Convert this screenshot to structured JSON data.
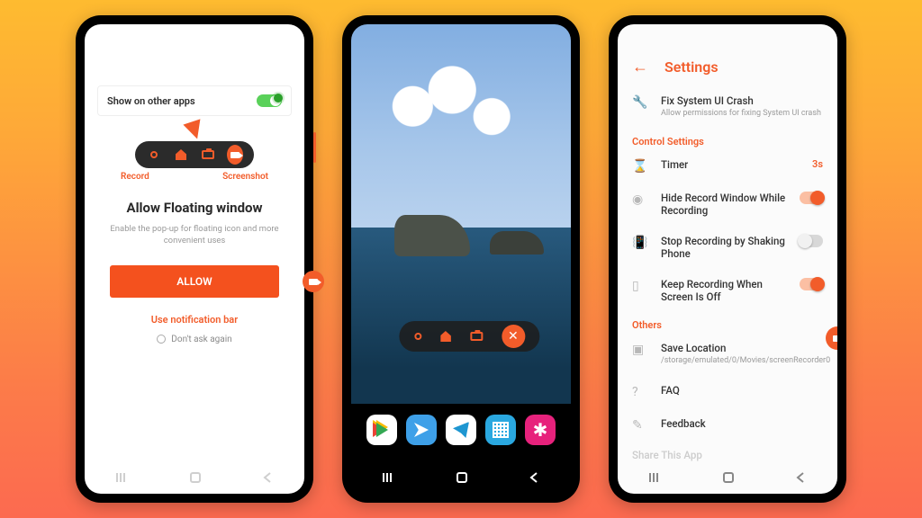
{
  "phone1": {
    "card_label": "Show on other apps",
    "pill_labels": {
      "record": "Record",
      "screenshot": "Screenshot"
    },
    "heading": "Allow Floating window",
    "subtext": "Enable the pop-up for floating icon and more convenient uses",
    "allow_button": "ALLOW",
    "notification_link": "Use notification bar",
    "dont_ask": "Don't ask again"
  },
  "phone2": {
    "pill_icons": [
      "record",
      "home",
      "camera",
      "close"
    ],
    "dock_apps": [
      "play-store",
      "bird",
      "telegram",
      "qr",
      "flower"
    ]
  },
  "phone3": {
    "title": "Settings",
    "fix_ui": {
      "title": "Fix System UI Crash",
      "sub": "Allow permissions for fixing System UI crash"
    },
    "section_control": "Control Settings",
    "timer": {
      "label": "Timer",
      "value": "3s"
    },
    "hide_window": {
      "label": "Hide Record Window While Recording",
      "on": true
    },
    "shake": {
      "label": "Stop Recording by Shaking Phone",
      "on": false
    },
    "keep_off": {
      "label": "Keep Recording When Screen Is Off",
      "on": true
    },
    "section_others": "Others",
    "save": {
      "title": "Save Location",
      "sub": "/storage/emulated/0/Movies/screenRecorder0"
    },
    "faq": "FAQ",
    "feedback": "Feedback",
    "share": "Share This App"
  }
}
